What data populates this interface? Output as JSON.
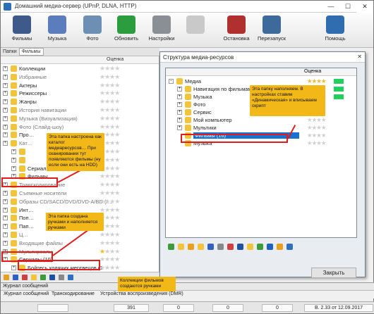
{
  "window": {
    "title": "Домашний медиа-сервер (UPnP, DLNA, HTTP)",
    "controls": [
      "—",
      "☐",
      "✕"
    ]
  },
  "toolbar": {
    "buttons": [
      {
        "label": "Фильмы",
        "icon": "film-icon",
        "color": "#3d5a8a"
      },
      {
        "label": "Музыка",
        "icon": "music-icon",
        "color": "#5b7cbd"
      },
      {
        "label": "Фото",
        "icon": "photo-icon",
        "color": "#6c8fb3"
      },
      {
        "label": "Обновить",
        "icon": "refresh-icon",
        "color": "#2c9d3e"
      },
      {
        "label": "Настройки",
        "icon": "settings-icon",
        "color": "#8a8f95"
      },
      {
        "label": "",
        "icon": "disabled-icon",
        "color": "#c9c9c9"
      },
      {
        "label": "Остановка",
        "icon": "stop-server-icon",
        "color": "#b03030"
      },
      {
        "label": "Перезапуск",
        "icon": "restart-server-icon",
        "color": "#3d6a9a"
      },
      {
        "label": "Помощь",
        "icon": "help-icon",
        "color": "#2f6db0"
      }
    ]
  },
  "panel_tabs": [
    "Папки",
    "Фильмы"
  ],
  "left_panel": {
    "rating_header": "Оценка",
    "items": [
      {
        "label": "Коллекции",
        "color": "#f2c43c",
        "stars": 0,
        "gray": false
      },
      {
        "label": "Избранные",
        "color": "#f2c43c",
        "stars": 0,
        "gray": true
      },
      {
        "label": "Актеры",
        "color": "#f2c43c",
        "stars": 0,
        "gray": false
      },
      {
        "label": "Режиссеры",
        "color": "#f2c43c",
        "stars": 0,
        "gray": false
      },
      {
        "label": "Жанры",
        "color": "#f2c43c",
        "stars": 0,
        "gray": false
      },
      {
        "label": "История навигации",
        "color": "#f2c43c",
        "stars": 0,
        "gray": true
      },
      {
        "label": "Музыка (Визуализация)",
        "color": "#f2c43c",
        "stars": 0,
        "gray": true
      },
      {
        "label": "Фото (Слайд-шоу)",
        "color": "#f2c43c",
        "stars": 0,
        "gray": true
      },
      {
        "label": "Про…",
        "color": "#f2c43c",
        "stars": 0,
        "gray": false
      },
      {
        "label": "Кат…",
        "color": "#f2c43c",
        "stars": 0,
        "gray": true
      },
      {
        "label": "",
        "color": "#f2c43c",
        "stars": 0,
        "gray": false
      },
      {
        "label": "",
        "color": "#f2c43c",
        "stars": 0,
        "gray": false
      },
      {
        "label": "Сериалы",
        "color": "#f2c43c",
        "stars": 0,
        "gray": false
      },
      {
        "label": "Фильмы",
        "color": "#f2c43c",
        "stars": 0,
        "gray": false
      },
      {
        "label": "Транскодирование",
        "color": "#f2c43c",
        "stars": 0,
        "gray": true
      },
      {
        "label": "Съемные носители",
        "color": "#f2c43c",
        "stars": 0,
        "gray": true
      },
      {
        "label": "Образы CD/SACD/DVD/DVD-A/BD (I…",
        "color": "#f2c43c",
        "stars": 0,
        "gray": true
      },
      {
        "label": "Инт…",
        "color": "#f2c43c",
        "stars": 0,
        "gray": false
      },
      {
        "label": "Поп…",
        "color": "#f2c43c",
        "stars": 0,
        "gray": false
      },
      {
        "label": "Пап…",
        "color": "#f2c43c",
        "stars": 0,
        "gray": false
      },
      {
        "label": "Ц…",
        "color": "#f2c43c",
        "stars": 0,
        "gray": true
      },
      {
        "label": "Входящие файлы",
        "color": "#f2c43c",
        "stars": 0,
        "gray": true
      },
      {
        "label": "Мультиреалы",
        "color": "#f2c43c",
        "stars": 1,
        "gray": true
      },
      {
        "label": "Сериалы (10)",
        "color": "#f2c43c",
        "stars": 0,
        "gray": false
      },
      {
        "label": "Бойтесь ходячих мертвецов (1",
        "color": "#f2c43c",
        "stars": 0,
        "gray": false
      }
    ]
  },
  "dialog": {
    "title": "Структура медиа-ресурсов",
    "rating_header": "Оценка",
    "tree": [
      {
        "label": "Медиа",
        "stars": 5,
        "green": true,
        "expand": "-"
      },
      {
        "label": "Навигация по фильмам",
        "stars": 0,
        "green": true,
        "expand": "+"
      },
      {
        "label": "Музыка",
        "stars": 0,
        "green": true,
        "expand": "+"
      },
      {
        "label": "Фото",
        "stars": 0,
        "green": false,
        "expand": "+"
      },
      {
        "label": "Сервис",
        "stars": 0,
        "green": false,
        "expand": "+"
      },
      {
        "label": "Мой компьютер",
        "stars": 0,
        "green": false,
        "expand": "+"
      },
      {
        "label": "Мультики",
        "stars": 0,
        "green": false,
        "expand": "+"
      },
      {
        "label": "Фильмы (16)",
        "stars": 0,
        "green": false,
        "expand": "",
        "selected": true
      },
      {
        "label": "Музыка",
        "stars": 0,
        "green": false,
        "expand": ""
      }
    ],
    "close_button": "Закрыть"
  },
  "annotations": {
    "a1": "Эта папка настроена как каталог медиаресурсов… При сканировании тут появляются фильмы (ну если они есть на HDD)",
    "a2": "Эта папку наполняем. В настройках ставим «Динамическая» и вписываем скрипт",
    "a3": "Эта папка создана ручками и наполняется ручками",
    "a4": "Коллекции фильмов создаются ручками"
  },
  "log": {
    "title": "Журнал сообщений",
    "tabs": [
      "Журнал сообщений",
      "Транскодирование",
      "Устройства воспроизведения (DMR)"
    ]
  },
  "status": {
    "values": [
      "391",
      "0",
      "0",
      "0"
    ],
    "version": "В. 2.33 от 12.09.2017"
  },
  "colors": {
    "selection": "#1a6fd0",
    "annotation": "#f2b818",
    "highlight": "#e01d1d",
    "rating_green": "#22d060"
  }
}
